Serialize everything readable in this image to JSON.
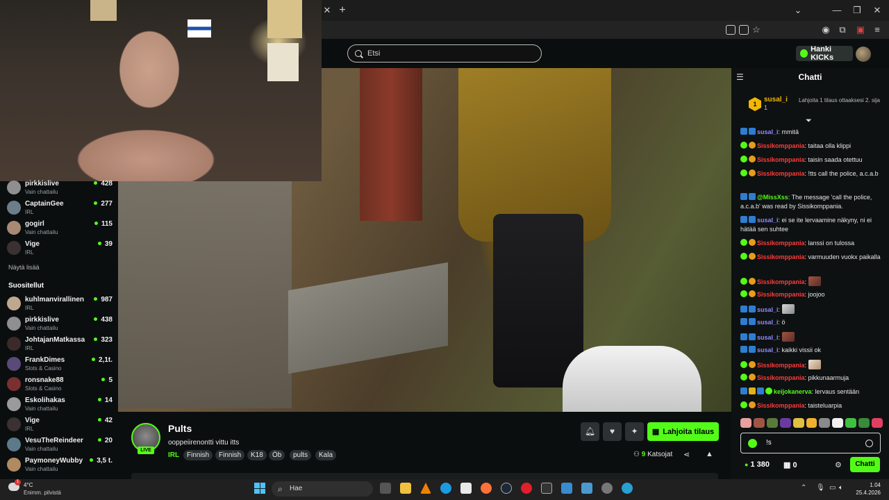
{
  "browser": {
    "new_tab_glyph": "+",
    "close_glyph": "✕"
  },
  "header": {
    "search_placeholder": "Etsi",
    "kicks_label": "Hanki KICKs"
  },
  "sidebar": {
    "following": [
      {
        "name": "pirkkislive",
        "category": "Vain chattailu",
        "viewers": "428"
      },
      {
        "name": "CaptainGee",
        "category": "IRL",
        "viewers": "277"
      },
      {
        "name": "gogirl",
        "category": "Vain chattailu",
        "viewers": "115"
      },
      {
        "name": "Vige",
        "category": "IRL",
        "viewers": "39"
      }
    ],
    "show_more": "Näytä lisää",
    "recommended_title": "Suositellut",
    "recommended": [
      {
        "name": "kuhlmanvirallinen",
        "category": "IRL",
        "viewers": "987"
      },
      {
        "name": "pirkkislive",
        "category": "Vain chattailu",
        "viewers": "438"
      },
      {
        "name": "JohtajanMatkassa",
        "category": "IRL",
        "viewers": "323"
      },
      {
        "name": "FrankDimes",
        "category": "Slots & Casino",
        "viewers": "2,1t."
      },
      {
        "name": "ronsnake88",
        "category": "Slots & Casino",
        "viewers": "5"
      },
      {
        "name": "Eskolihakas",
        "category": "Vain chattailu",
        "viewers": "14"
      },
      {
        "name": "Vige",
        "category": "IRL",
        "viewers": "42"
      },
      {
        "name": "VesuTheReindeer",
        "category": "Vain chattailu",
        "viewers": "20"
      },
      {
        "name": "PaymoneyWubby",
        "category": "Vain chattailu",
        "viewers": "3,5 t."
      }
    ]
  },
  "stream": {
    "name": "Pults",
    "title": "ooppeiirenontti vittu itts",
    "category": "IRL",
    "live_label": "LIVE",
    "tags": [
      "Finnish",
      "Finnish",
      "K18",
      "Öb",
      "pults",
      "Kala"
    ],
    "subscribe_label": "Lahjoita tilaus",
    "viewer_count": "9",
    "viewer_label": "Katsojat"
  },
  "chat": {
    "title": "Chatti",
    "pinned": {
      "rank": "1",
      "user": "susal_i",
      "count": "1",
      "text": "Lahjoita 1 tilaus ottaaksesi 2. sija"
    },
    "messages": [
      {
        "user": "susal_i",
        "color": "blue",
        "text": "mmitä"
      },
      {
        "user": "Sissikomppania",
        "color": "red",
        "text": "taitaa olla klippi"
      },
      {
        "user": "Sissikomppania",
        "color": "red",
        "text": "taisin saada otettuu"
      },
      {
        "user": "Sissikomppania",
        "color": "red",
        "text": "!tts call the police, a.c.a.b"
      },
      {
        "user": "@MissXss",
        "color": "blue",
        "text": "The message 'call the police, a.c.a.b' was read by Sissikomppania."
      },
      {
        "user": "susal_i",
        "color": "blue",
        "text": "ei se ite lervaamine näkyny, ni ei hätää sen suhtee"
      },
      {
        "user": "Sissikomppania",
        "color": "red",
        "text": "lanssi on tulossa"
      },
      {
        "user": "Sissikomppania",
        "color": "red",
        "text": "varmuuden vuokx paikalla"
      },
      {
        "user": "Sissikomppania",
        "color": "red",
        "text": ""
      },
      {
        "user": "Sissikomppania",
        "color": "red",
        "text": "joojoo"
      },
      {
        "user": "susal_i",
        "color": "blue",
        "text": ""
      },
      {
        "user": "susal_i",
        "color": "blue",
        "text": "ö"
      },
      {
        "user": "susal_i",
        "color": "blue",
        "text": ""
      },
      {
        "user": "susal_i",
        "color": "blue",
        "text": "kaikki vissii ok"
      },
      {
        "user": "Sissikomppania",
        "color": "red",
        "text": ""
      },
      {
        "user": "Sissikomppania",
        "color": "red",
        "text": "pikkunaarmuja"
      },
      {
        "user": "keijokanerva",
        "color": "green",
        "text": "lervaus sentään"
      },
      {
        "user": "Sissikomppania",
        "color": "red",
        "text": "taisteluarpia"
      }
    ],
    "input_value": "!s",
    "kicks_balance": "1 380",
    "gifts_count": "0",
    "send_label": "Chatti"
  },
  "taskbar": {
    "temperature": "4°C",
    "weather": "Enimm. pilvistä",
    "weather_badge": "1",
    "search_label": "Hae",
    "time": "1.04",
    "date": "25.4.2026"
  },
  "colors": {
    "accent": "#53fc18",
    "mod": "#2e7dd1",
    "red_user": "#ff3b3b",
    "blue_user": "#8e8bff"
  }
}
